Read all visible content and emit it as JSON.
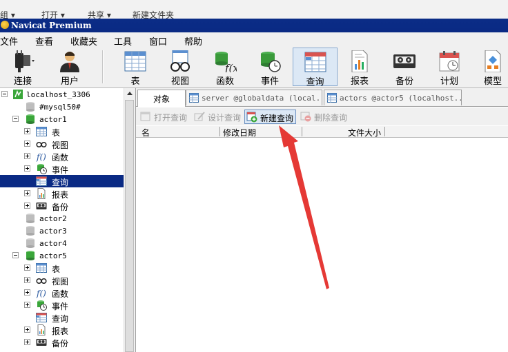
{
  "explorer_strip": {
    "items": [
      "组 ▾",
      "打开 ▾",
      "共享 ▾",
      "新建文件夹"
    ]
  },
  "window": {
    "title": "Navicat Premium"
  },
  "menu": {
    "items": [
      "文件",
      "查看",
      "收藏夹",
      "工具",
      "窗口",
      "帮助"
    ]
  },
  "toolbar": {
    "buttons": [
      {
        "label": "连接",
        "icon": "plug-icon"
      },
      {
        "label": "用户",
        "icon": "user-icon"
      },
      {
        "label": "表",
        "icon": "table-icon"
      },
      {
        "label": "视图",
        "icon": "glasses-icon"
      },
      {
        "label": "函数",
        "icon": "function-icon"
      },
      {
        "label": "事件",
        "icon": "event-clock-icon"
      },
      {
        "label": "查询",
        "icon": "query-icon",
        "active": true
      },
      {
        "label": "报表",
        "icon": "report-icon"
      },
      {
        "label": "备份",
        "icon": "tape-backup-icon"
      },
      {
        "label": "计划",
        "icon": "calendar-icon"
      },
      {
        "label": "模型",
        "icon": "model-icon"
      }
    ]
  },
  "tree": {
    "connection": "localhost_3306",
    "nodes": [
      {
        "label": "#mysql50#",
        "type": "db-closed"
      },
      {
        "label": "actor1",
        "type": "db-open"
      },
      {
        "label": "表",
        "type": "tables"
      },
      {
        "label": "视图",
        "type": "views"
      },
      {
        "label": "函数",
        "type": "functions"
      },
      {
        "label": "事件",
        "type": "events"
      },
      {
        "label": "查询",
        "type": "queries",
        "selected": true
      },
      {
        "label": "报表",
        "type": "reports"
      },
      {
        "label": "备份",
        "type": "backups"
      },
      {
        "label": "actor2",
        "type": "db-closed"
      },
      {
        "label": "actor3",
        "type": "db-closed"
      },
      {
        "label": "actor4",
        "type": "db-closed"
      },
      {
        "label": "actor5",
        "type": "db-open"
      },
      {
        "label": "表",
        "type": "tables"
      },
      {
        "label": "视图",
        "type": "views"
      },
      {
        "label": "函数",
        "type": "functions"
      },
      {
        "label": "事件",
        "type": "events"
      },
      {
        "label": "查询",
        "type": "queries"
      },
      {
        "label": "报表",
        "type": "reports"
      },
      {
        "label": "备份",
        "type": "backups"
      }
    ]
  },
  "tabs": [
    {
      "label": "对象",
      "active": true
    },
    {
      "label": "server @globaldata (local..."
    },
    {
      "label": "actors @actor5 (localhost..."
    }
  ],
  "object_toolbar": {
    "buttons": [
      {
        "label": "打开查询",
        "enabled": false
      },
      {
        "label": "设计查询",
        "enabled": false
      },
      {
        "label": "新建查询",
        "enabled": true
      },
      {
        "label": "删除查询",
        "enabled": false
      }
    ]
  },
  "list_header": {
    "columns": [
      "名",
      "修改日期",
      "文件大小"
    ]
  },
  "colors": {
    "titlebar": "#0a2a84",
    "selection": "#0a2a84",
    "annotation_arrow": "#e53935",
    "db_green": "#3aa63a"
  }
}
